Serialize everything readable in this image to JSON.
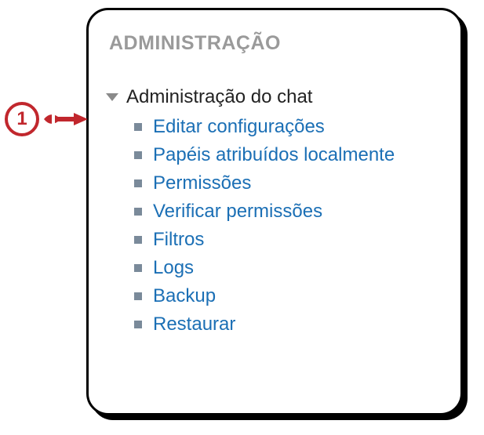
{
  "panel": {
    "title": "ADMINISTRAÇÃO"
  },
  "section": {
    "label": "Administração do chat",
    "items": [
      "Editar configurações",
      "Papéis atribuídos localmente",
      "Permissões",
      "Verificar permissões",
      "Filtros",
      "Logs",
      "Backup",
      "Restaurar"
    ]
  },
  "callout": {
    "number": "1"
  }
}
